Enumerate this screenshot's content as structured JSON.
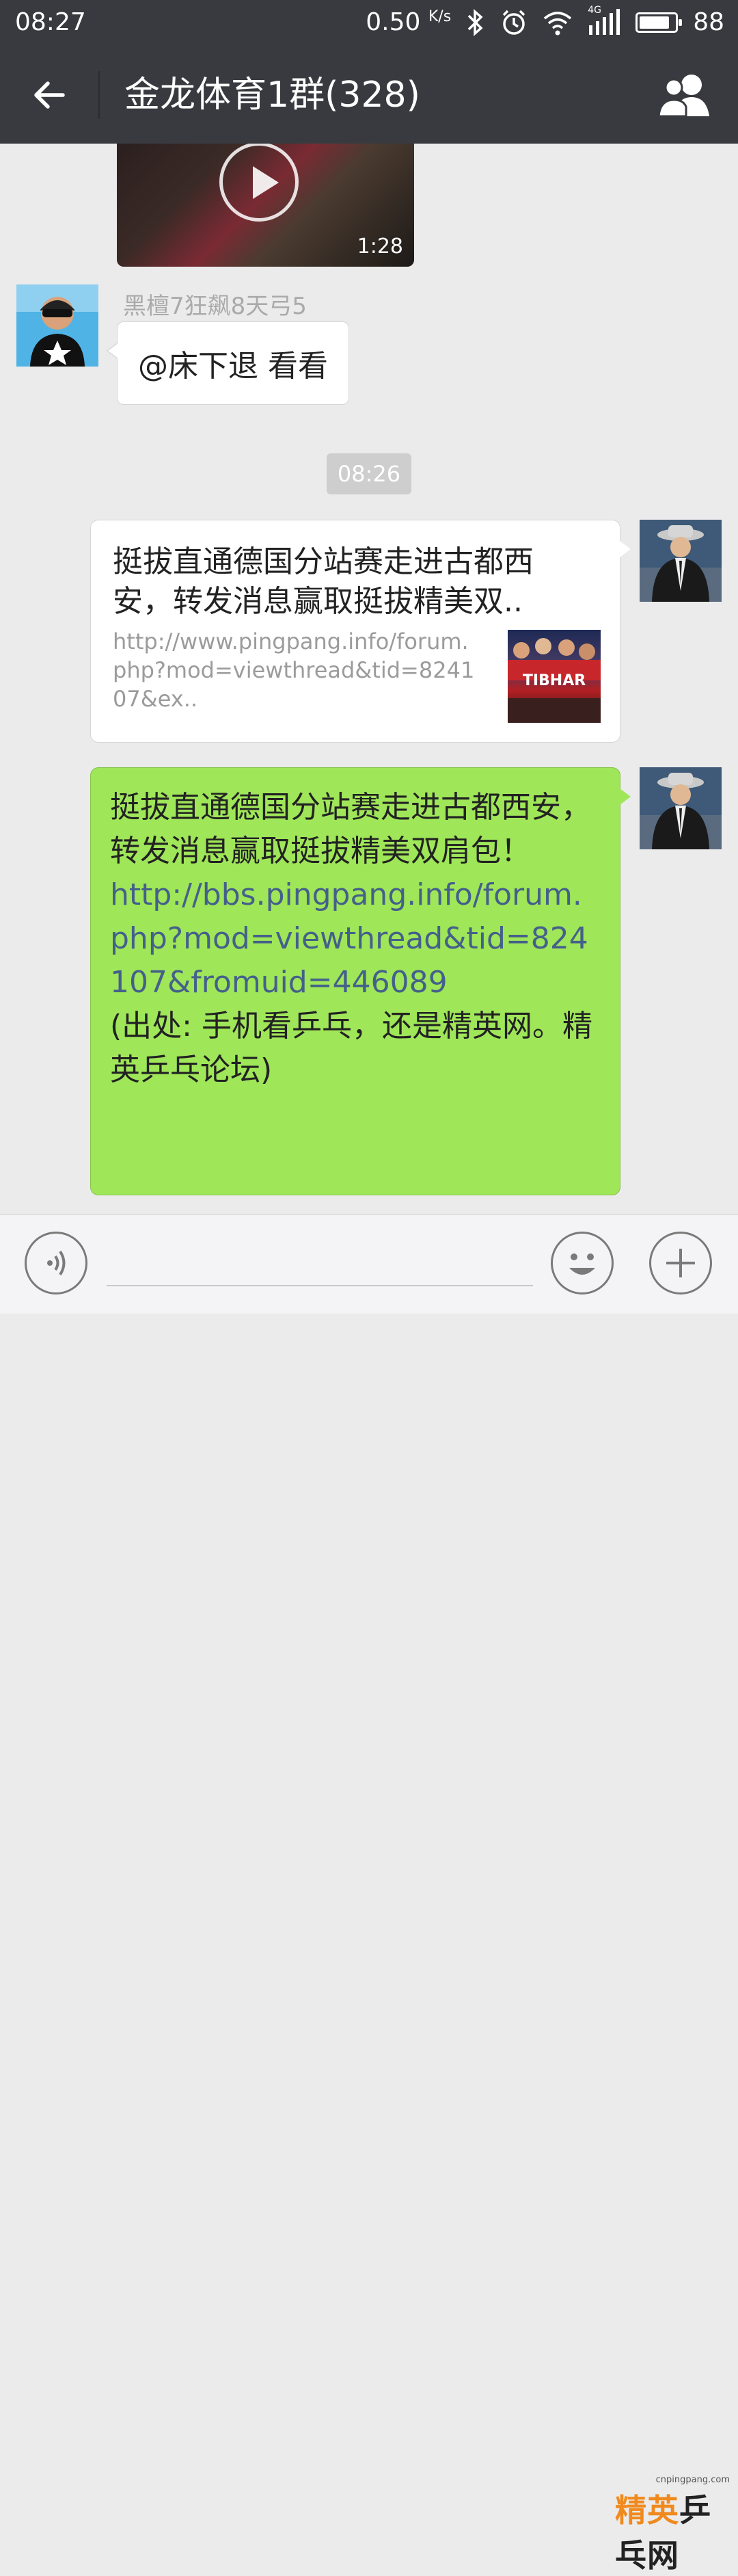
{
  "status_bar": {
    "time": "08:27",
    "speed": "0.50",
    "speed_unit": "K/s",
    "network": "4G",
    "battery": "88",
    "battery_level": 0.88
  },
  "header": {
    "title": "金龙体育1群(328)",
    "back_icon": "arrow-left-icon",
    "members_icon": "group-members-icon"
  },
  "messages": {
    "video": {
      "duration": "1:28"
    },
    "received": {
      "sender": "黑檀7狂飙8天弓5",
      "text": "@床下退 看看"
    },
    "timestamp": "08:26",
    "link_card": {
      "title": "挺拔直通德国分站赛走进古都西安，转发消息赢取挺拔精美双..",
      "url": "http://www.pingpang.info/forum.php?mod=viewthread&tid=824107&ex..",
      "thumb_text": "TIBHAR"
    },
    "sent_text": {
      "line1": "挺拔直通德国分站赛走进古都西安，转发消息赢取挺拔精美双肩包！",
      "link": "http://bbs.pingpang.info/forum.php?mod=viewthread&tid=824107&fromuid=446089",
      "line2": "(出处: 手机看乒乓，还是精英网。精英乒乓论坛)"
    }
  },
  "input_bar": {
    "voice_icon": "voice-icon",
    "emoji_icon": "emoji-icon",
    "plus_icon": "plus-icon"
  },
  "watermark": {
    "small": "cnpingpang.com",
    "brand_a": "精英",
    "brand_b": "乒乓网"
  },
  "colors": {
    "header_bg": "#393a3f",
    "chat_bg": "#ebebeb",
    "sent_bubble": "#9fe659",
    "link_text": "#44608a"
  }
}
